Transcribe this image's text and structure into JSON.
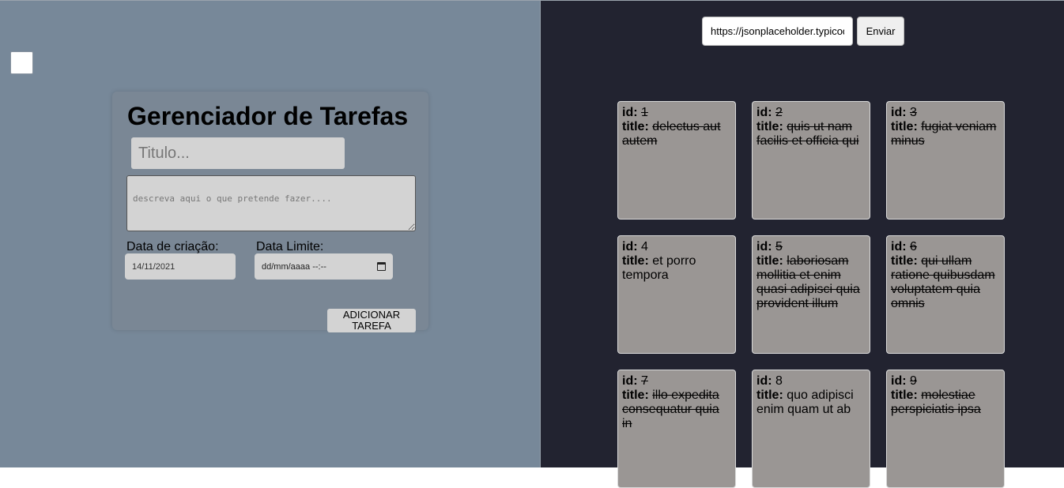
{
  "form": {
    "title": "Gerenciador de Tarefas",
    "title_placeholder": "Titulo...",
    "description_placeholder": "descreva aqui o que pretende fazer....",
    "created_label": "Data de criação:",
    "created_value": "14/11/2021",
    "limit_label": "Data Limite:",
    "limit_value": "dd/mm/aaaa --:--",
    "add_button": "ADICIONAR TAREFA"
  },
  "fetch": {
    "url_value": "https://jsonplaceholder.typicode.com/todos",
    "send_button": "Enviar"
  },
  "todo_labels": {
    "id": "id:",
    "title": "title:"
  },
  "todos": [
    {
      "id": "1",
      "title": "delectus aut autem",
      "completed": true
    },
    {
      "id": "2",
      "title": "quis ut nam facilis et officia qui",
      "completed": true
    },
    {
      "id": "3",
      "title": "fugiat veniam minus",
      "completed": true
    },
    {
      "id": "4",
      "title": "et porro tempora",
      "completed": false
    },
    {
      "id": "5",
      "title": "laboriosam mollitia et enim quasi adipisci quia provident illum",
      "completed": true
    },
    {
      "id": "6",
      "title": "qui ullam ratione quibusdam voluptatem quia omnis",
      "completed": true
    },
    {
      "id": "7",
      "title": "illo expedita consequatur quia in",
      "completed": true
    },
    {
      "id": "8",
      "title": "quo adipisci enim quam ut ab",
      "completed": false
    },
    {
      "id": "9",
      "title": "molestiae perspiciatis ipsa",
      "completed": true
    }
  ]
}
